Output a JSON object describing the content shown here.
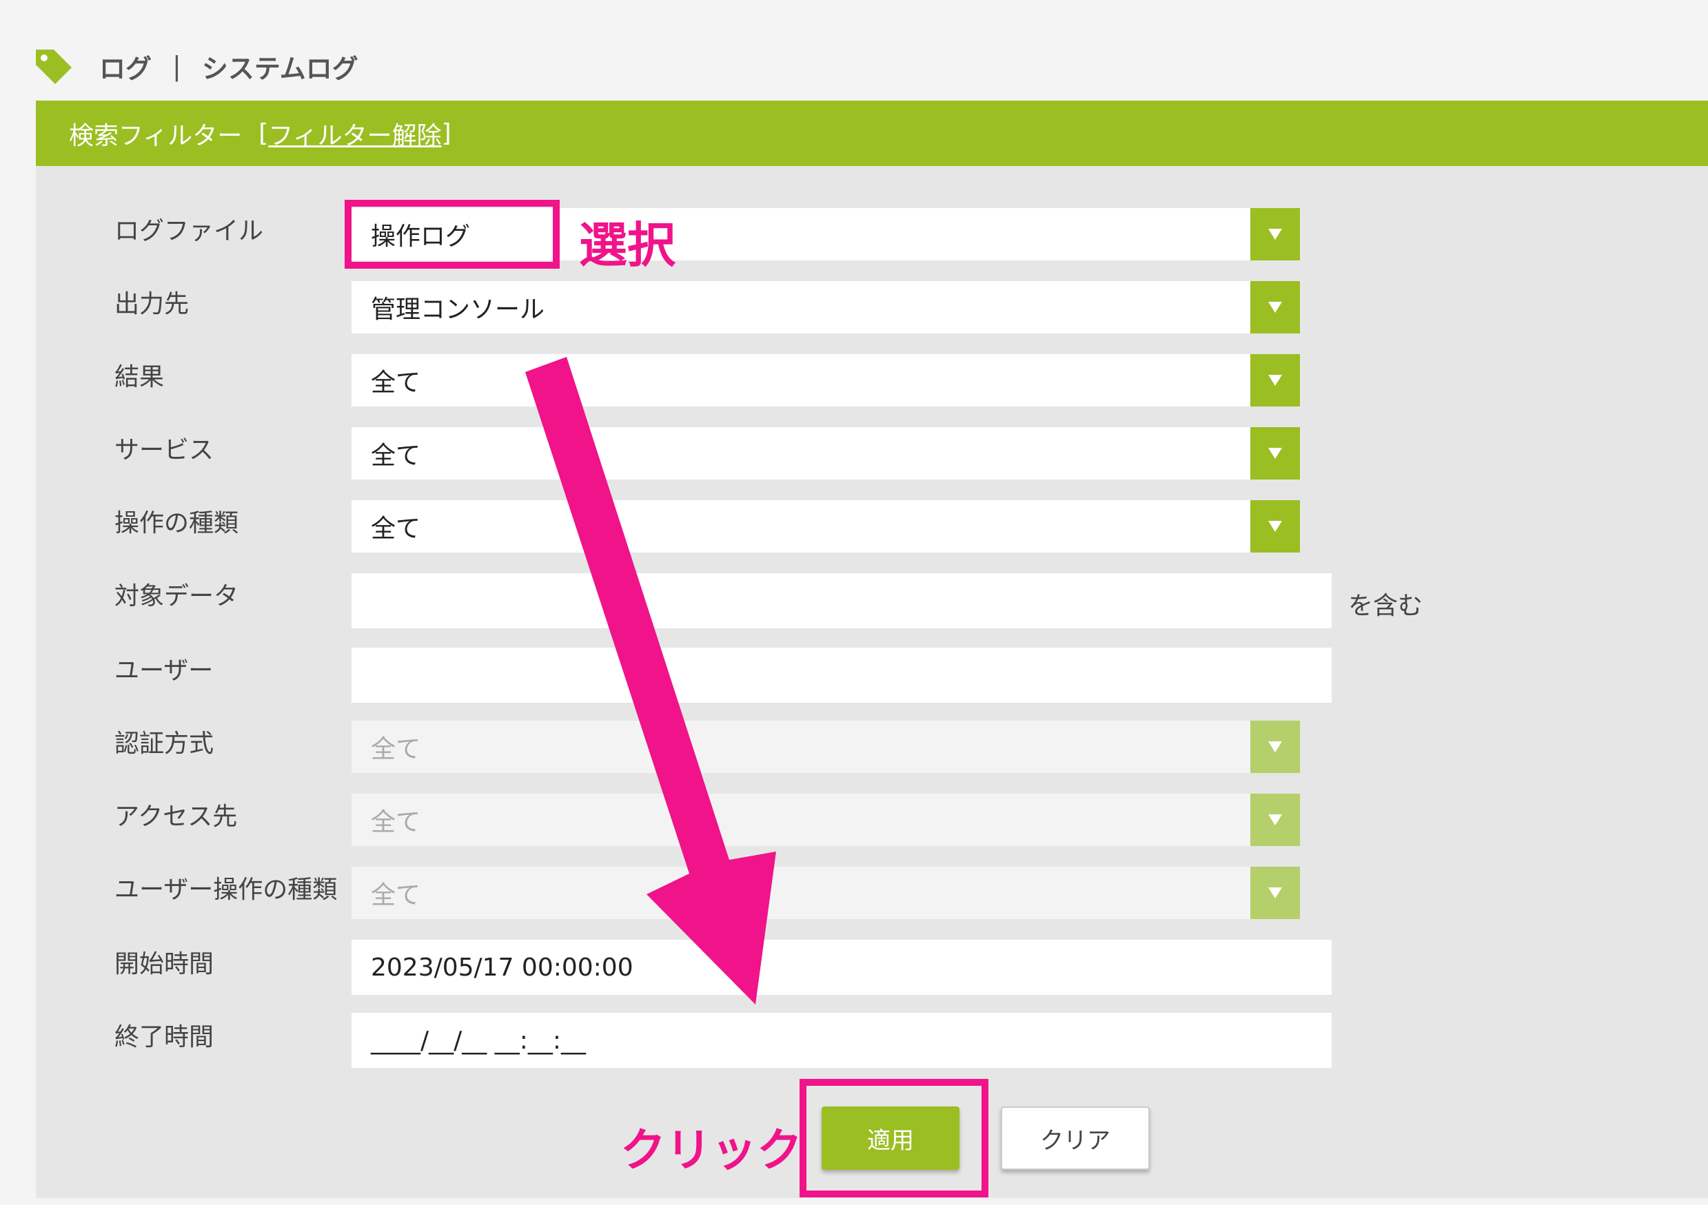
{
  "breadcrumb": {
    "part1": "ログ",
    "sep": "|",
    "part2": "システムログ"
  },
  "filter": {
    "title": "検索フィルター",
    "release_link": "フィルター解除",
    "bracket_open": "[",
    "bracket_close": "]"
  },
  "fields": {
    "logfile": {
      "label": "ログファイル",
      "value": "操作ログ"
    },
    "output": {
      "label": "出力先",
      "value": "管理コンソール"
    },
    "result": {
      "label": "結果",
      "value": "全て"
    },
    "service": {
      "label": "サービス",
      "value": "全て"
    },
    "op_type": {
      "label": "操作の種類",
      "value": "全て"
    },
    "target": {
      "label": "対象データ",
      "value": "",
      "suffix": "を含む"
    },
    "user": {
      "label": "ユーザー",
      "value": ""
    },
    "auth": {
      "label": "認証方式",
      "value": "全て"
    },
    "access": {
      "label": "アクセス先",
      "value": "全て"
    },
    "user_op": {
      "label": "ユーザー操作の種類",
      "value": "全て"
    },
    "start": {
      "label": "開始時間",
      "value": "2023/05/17 00:00:00"
    },
    "end": {
      "label": "終了時間",
      "value": "____/__/__ __:__:__"
    }
  },
  "buttons": {
    "apply": "適用",
    "clear": "クリア"
  },
  "annotations": {
    "select": "選択",
    "click": "クリック",
    "color": "#f0138a"
  },
  "colors": {
    "accent": "#9bbe22"
  }
}
